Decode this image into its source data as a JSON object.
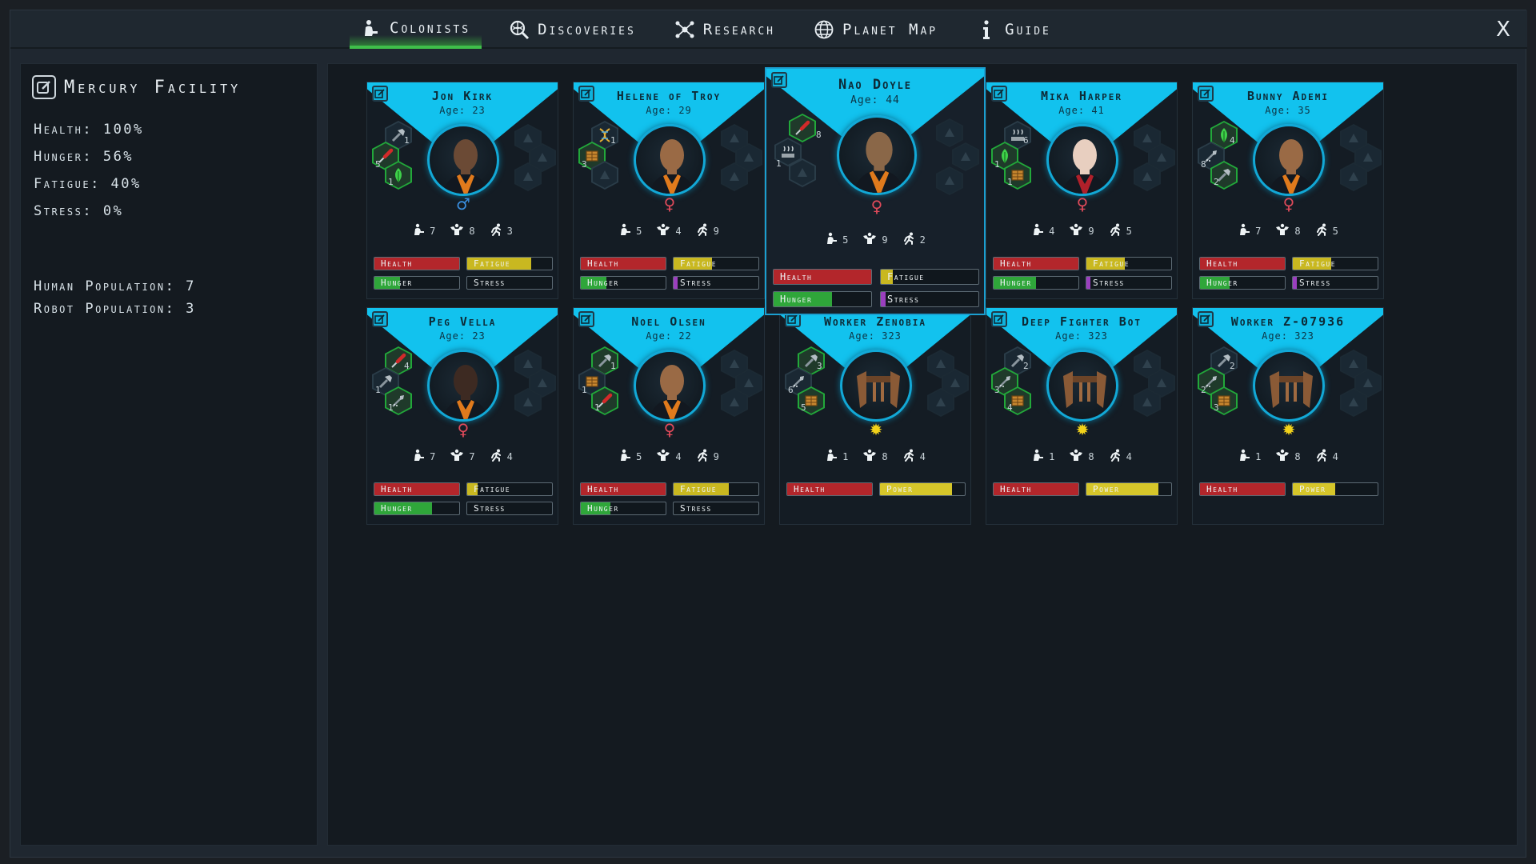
{
  "tabs": [
    {
      "label": "Colonists",
      "icon": "colonist-icon",
      "active": true
    },
    {
      "label": "Discoveries",
      "icon": "discoveries-icon",
      "active": false
    },
    {
      "label": "Research",
      "icon": "research-icon",
      "active": false
    },
    {
      "label": "Planet Map",
      "icon": "globe-icon",
      "active": false
    },
    {
      "label": "Guide",
      "icon": "info-icon",
      "active": false
    }
  ],
  "close_label": "X",
  "facility": {
    "name": "Mercury Facility",
    "health": "Health: 100%",
    "hunger": "Hunger: 56%",
    "fatigue": "Fatigue: 40%",
    "stress": "Stress: 0%",
    "human_population": "Human Population: 7",
    "robot_population": "Robot Population: 3"
  },
  "colors": {
    "health": "#b3262b",
    "fatigue": "#c9b820",
    "hunger": "#2fa63a",
    "stress": "#9b3fbf",
    "power": "#d6c62a",
    "accent": "#12c2ee"
  },
  "colonists": [
    {
      "name": "Jon Kirk",
      "age": "Age: 23",
      "type": "human",
      "gender": "♂",
      "gender_color": "#3a8fe0",
      "skin": "#6b4a35",
      "shirt": "#e07a1c",
      "skills": [
        "1",
        "5",
        "1"
      ],
      "attrs": [
        "7",
        "8",
        "3"
      ],
      "bars": [
        {
          "label": "Health",
          "kind": "health",
          "level": 1.0
        },
        {
          "label": "Fatigue",
          "kind": "fatigue",
          "level": 0.75
        },
        {
          "label": "Hunger",
          "kind": "hunger",
          "level": 0.3
        },
        {
          "label": "Stress",
          "kind": "stress",
          "level": 0.0
        }
      ]
    },
    {
      "name": "Helene of Troy",
      "age": "Age: 29",
      "type": "human",
      "gender": "♀",
      "gender_color": "#e04a5a",
      "skin": "#9a6a45",
      "shirt": "#e07a1c",
      "skills": [
        "1",
        "3",
        ""
      ],
      "attrs": [
        "5",
        "4",
        "9"
      ],
      "bars": [
        {
          "label": "Health",
          "kind": "health",
          "level": 1.0
        },
        {
          "label": "Fatigue",
          "kind": "fatigue",
          "level": 0.45
        },
        {
          "label": "Hunger",
          "kind": "hunger",
          "level": 0.3
        },
        {
          "label": "Stress",
          "kind": "stress",
          "level": 0.05
        }
      ]
    },
    {
      "name": "Nao Doyle",
      "age": "Age: 44",
      "type": "human",
      "gender": "♀",
      "gender_color": "#e04a5a",
      "skin": "#8a6748",
      "shirt": "#e07a1c",
      "skills": [
        "8",
        "1",
        ""
      ],
      "attrs": [
        "5",
        "9",
        "2"
      ],
      "bars": [
        {
          "label": "Health",
          "kind": "health",
          "level": 1.0
        },
        {
          "label": "Fatigue",
          "kind": "fatigue",
          "level": 0.12
        },
        {
          "label": "Hunger",
          "kind": "hunger",
          "level": 0.6
        },
        {
          "label": "Stress",
          "kind": "stress",
          "level": 0.05
        }
      ]
    },
    {
      "name": "Mika Harper",
      "age": "Age: 41",
      "type": "human",
      "gender": "♀",
      "gender_color": "#e04a5a",
      "skin": "#e8cfc0",
      "shirt": "#b0202a",
      "skills": [
        "6",
        "1",
        "1"
      ],
      "attrs": [
        "4",
        "9",
        "5"
      ],
      "bars": [
        {
          "label": "Health",
          "kind": "health",
          "level": 1.0
        },
        {
          "label": "Fatigue",
          "kind": "fatigue",
          "level": 0.45
        },
        {
          "label": "Hunger",
          "kind": "hunger",
          "level": 0.5
        },
        {
          "label": "Stress",
          "kind": "stress",
          "level": 0.05
        }
      ]
    },
    {
      "name": "Bunny Ademi",
      "age": "Age: 35",
      "type": "human",
      "gender": "♀",
      "gender_color": "#e04a5a",
      "skin": "#9a6a45",
      "shirt": "#e07a1c",
      "skills": [
        "4",
        "8",
        "2"
      ],
      "attrs": [
        "7",
        "8",
        "5"
      ],
      "bars": [
        {
          "label": "Health",
          "kind": "health",
          "level": 1.0
        },
        {
          "label": "Fatigue",
          "kind": "fatigue",
          "level": 0.45
        },
        {
          "label": "Hunger",
          "kind": "hunger",
          "level": 0.35
        },
        {
          "label": "Stress",
          "kind": "stress",
          "level": 0.05
        }
      ]
    },
    {
      "name": "Peg Vella",
      "age": "Age: 23",
      "type": "human",
      "gender": "♀",
      "gender_color": "#e04a5a",
      "skin": "#3d2a22",
      "shirt": "#e07a1c",
      "skills": [
        "4",
        "1",
        "1"
      ],
      "attrs": [
        "7",
        "7",
        "4"
      ],
      "bars": [
        {
          "label": "Health",
          "kind": "health",
          "level": 1.0
        },
        {
          "label": "Fatigue",
          "kind": "fatigue",
          "level": 0.12
        },
        {
          "label": "Hunger",
          "kind": "hunger",
          "level": 0.68
        },
        {
          "label": "Stress",
          "kind": "stress",
          "level": 0.0
        }
      ]
    },
    {
      "name": "Noel Olsen",
      "age": "Age: 22",
      "type": "human",
      "gender": "♀",
      "gender_color": "#e04a5a",
      "skin": "#9a6a45",
      "shirt": "#e07a1c",
      "skills": [
        "1",
        "1",
        "1"
      ],
      "attrs": [
        "5",
        "4",
        "9"
      ],
      "bars": [
        {
          "label": "Health",
          "kind": "health",
          "level": 1.0
        },
        {
          "label": "Fatigue",
          "kind": "fatigue",
          "level": 0.65
        },
        {
          "label": "Hunger",
          "kind": "hunger",
          "level": 0.35
        },
        {
          "label": "Stress",
          "kind": "stress",
          "level": 0.0
        }
      ]
    },
    {
      "name": "Worker Zenobia",
      "age": "Age: 323",
      "type": "robot",
      "gender": "✹",
      "gender_color": "#f2d21a",
      "skills": [
        "3",
        "6",
        "5"
      ],
      "attrs": [
        "1",
        "8",
        "4"
      ],
      "bars": [
        {
          "label": "Health",
          "kind": "health",
          "level": 1.0
        },
        {
          "label": "Power",
          "kind": "power",
          "level": 0.85
        }
      ]
    },
    {
      "name": "Deep Fighter Bot",
      "age": "Age: 323",
      "type": "robot",
      "gender": "✹",
      "gender_color": "#f2d21a",
      "skills": [
        "2",
        "3",
        "4"
      ],
      "attrs": [
        "1",
        "8",
        "4"
      ],
      "bars": [
        {
          "label": "Health",
          "kind": "health",
          "level": 1.0
        },
        {
          "label": "Power",
          "kind": "power",
          "level": 0.85
        }
      ]
    },
    {
      "name": "Worker Z-07936",
      "age": "Age: 323",
      "type": "robot",
      "gender": "✹",
      "gender_color": "#f2d21a",
      "skills": [
        "2",
        "2",
        "3"
      ],
      "attrs": [
        "1",
        "8",
        "4"
      ],
      "bars": [
        {
          "label": "Health",
          "kind": "health",
          "level": 1.0
        },
        {
          "label": "Power",
          "kind": "power",
          "level": 0.5
        }
      ]
    }
  ]
}
